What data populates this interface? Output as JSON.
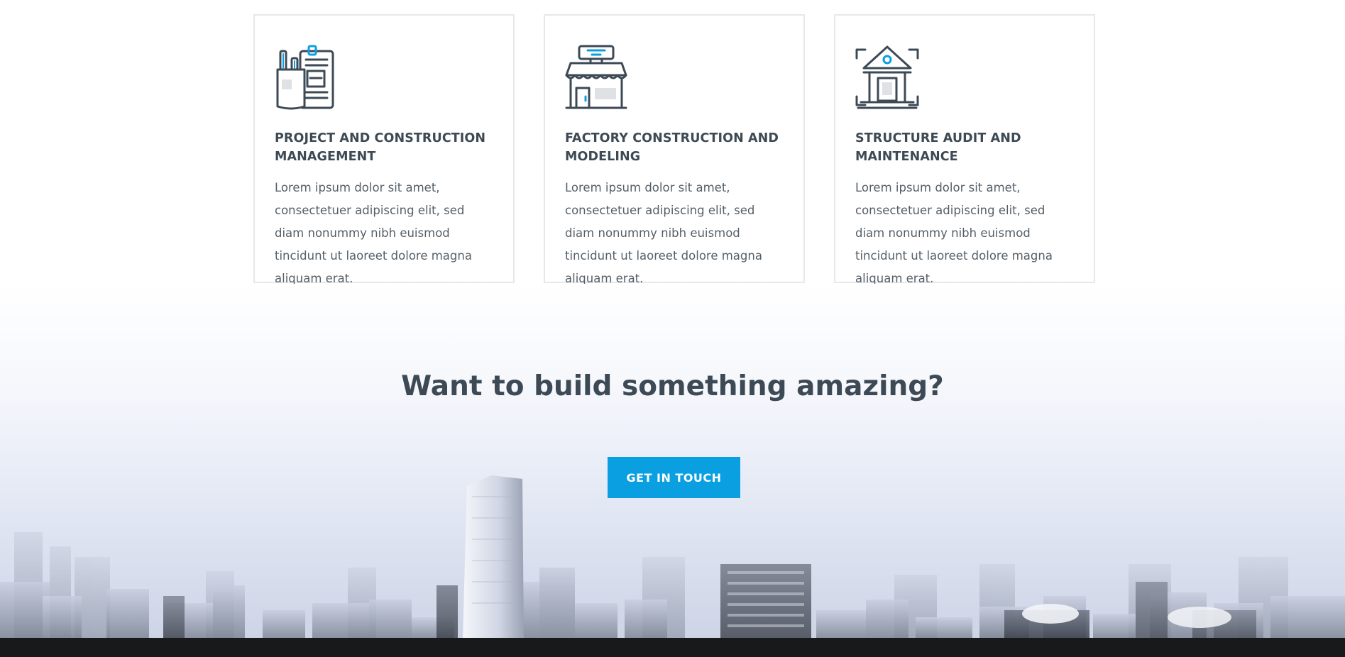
{
  "services": [
    {
      "icon": "clipboard-pencil-cup-icon",
      "title": "PROJECT AND CONSTRUCTION MANAGEMENT",
      "text": "Lorem ipsum dolor sit amet, consectetuer adipiscing elit, sed diam nonummy nibh euismod tincidunt ut laoreet dolore magna aliquam erat."
    },
    {
      "icon": "storefront-icon",
      "title": "FACTORY CONSTRUCTION AND MODELING",
      "text": "Lorem ipsum dolor sit amet, consectetuer adipiscing elit, sed diam nonummy nibh euismod tincidunt ut laoreet dolore magna aliquam erat."
    },
    {
      "icon": "institution-building-icon",
      "title": "STRUCTURE AUDIT AND MAINTENANCE",
      "text": "Lorem ipsum dolor sit amet, consectetuer adipiscing elit, sed diam nonummy nibh euismod tincidunt ut laoreet dolore magna aliquam erat."
    }
  ],
  "cta": {
    "heading": "Want to build something amazing?",
    "button_label": "GET IN TOUCH"
  },
  "colors": {
    "accent": "#0a9fe1",
    "heading": "#3d4a55",
    "body_text": "#555f68",
    "card_border": "#e6e8ea",
    "footer": "#17191b"
  }
}
